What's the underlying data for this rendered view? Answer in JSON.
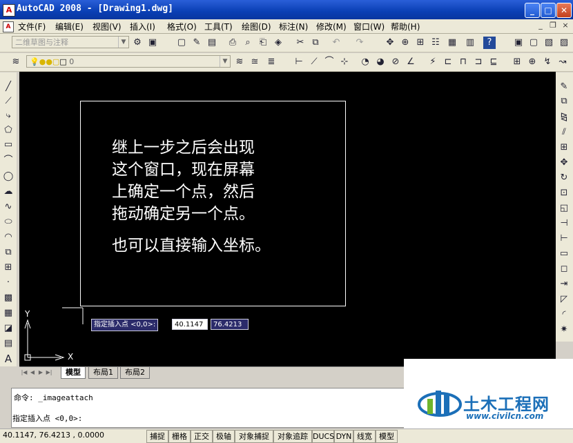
{
  "window": {
    "title": "AutoCAD 2008 - [Drawing1.dwg]",
    "minimize": "_",
    "maximize": "□",
    "close": "✕",
    "app_icon": "A"
  },
  "menu": [
    {
      "label": "文件(F)"
    },
    {
      "label": "编辑(E)"
    },
    {
      "label": "视图(V)"
    },
    {
      "label": "插入(I)"
    },
    {
      "label": "格式(O)"
    },
    {
      "label": "工具(T)"
    },
    {
      "label": "绘图(D)"
    },
    {
      "label": "标注(N)"
    },
    {
      "label": "修改(M)"
    },
    {
      "label": "窗口(W)"
    },
    {
      "label": "帮助(H)"
    }
  ],
  "mdi_controls": {
    "minimize": "_",
    "restore": "❐",
    "close": "×"
  },
  "workspace": {
    "value": "二维草图与注释"
  },
  "layer": {
    "value": "0"
  },
  "instruction": {
    "lines": [
      "继上一步之后会出现",
      "这个窗口，现在屏幕",
      "上确定一个点，然后",
      "拖动确定另一个点。"
    ],
    "extra": "也可以直接输入坐标。"
  },
  "dynamic_input": {
    "prompt": "指定插入点 <0,0>:",
    "x": "40.1147",
    "y": "76.4213"
  },
  "ucs": {
    "x_label": "X",
    "y_label": "Y"
  },
  "tabs": [
    {
      "label": "模型"
    },
    {
      "label": "布局1"
    },
    {
      "label": "布局2"
    }
  ],
  "command": {
    "history": "命令: _imageattach",
    "current": "指定插入点 <0,0>:"
  },
  "status": {
    "coords": "40.1147,  76.4213 , 0.0000",
    "buttons": [
      "捕捉",
      "栅格",
      "正交",
      "极轴",
      "对象捕捉",
      "对象追踪",
      "DUCS",
      "DYN",
      "线宽",
      "模型"
    ]
  },
  "watermark": {
    "name": "土木工程网",
    "url": "www.civilcn.com"
  }
}
